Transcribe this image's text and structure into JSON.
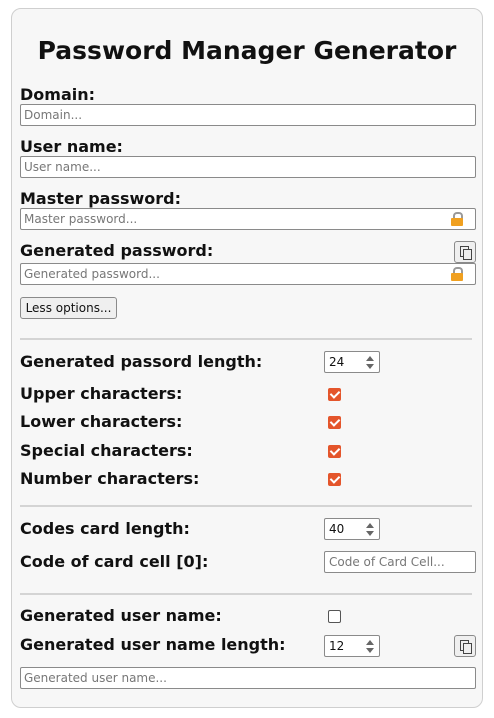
{
  "title": "Password Manager Generator",
  "domain": {
    "label": "Domain:",
    "placeholder": "Domain..."
  },
  "username": {
    "label": "User name:",
    "placeholder": "User name..."
  },
  "master": {
    "label": "Master password:",
    "placeholder": "Master password...",
    "icon": "lock-icon"
  },
  "generated": {
    "label": "Generated password:",
    "placeholder": "Generated password...",
    "icon": "lock-icon",
    "copy_icon": "copy-icon"
  },
  "less_options_label": "Less options...",
  "options": {
    "length_label": "Generated passord length:",
    "length_value": "24",
    "upper_label": "Upper characters:",
    "upper_checked": true,
    "lower_label": "Lower characters:",
    "lower_checked": true,
    "special_label": "Special characters:",
    "special_checked": true,
    "number_label": "Number characters:",
    "number_checked": true
  },
  "codes": {
    "length_label": "Codes card length:",
    "length_value": "40",
    "cell_label": "Code of card cell [0]:",
    "cell_placeholder": "Code of Card Cell..."
  },
  "gen_user": {
    "label": "Generated user name:",
    "checked": false,
    "length_label": "Generated user name length:",
    "length_value": "12",
    "placeholder": "Generated user name..."
  },
  "colors": {
    "accent": "#e4552b",
    "lock": "#f0a020",
    "panel": "#f7f7f7"
  }
}
